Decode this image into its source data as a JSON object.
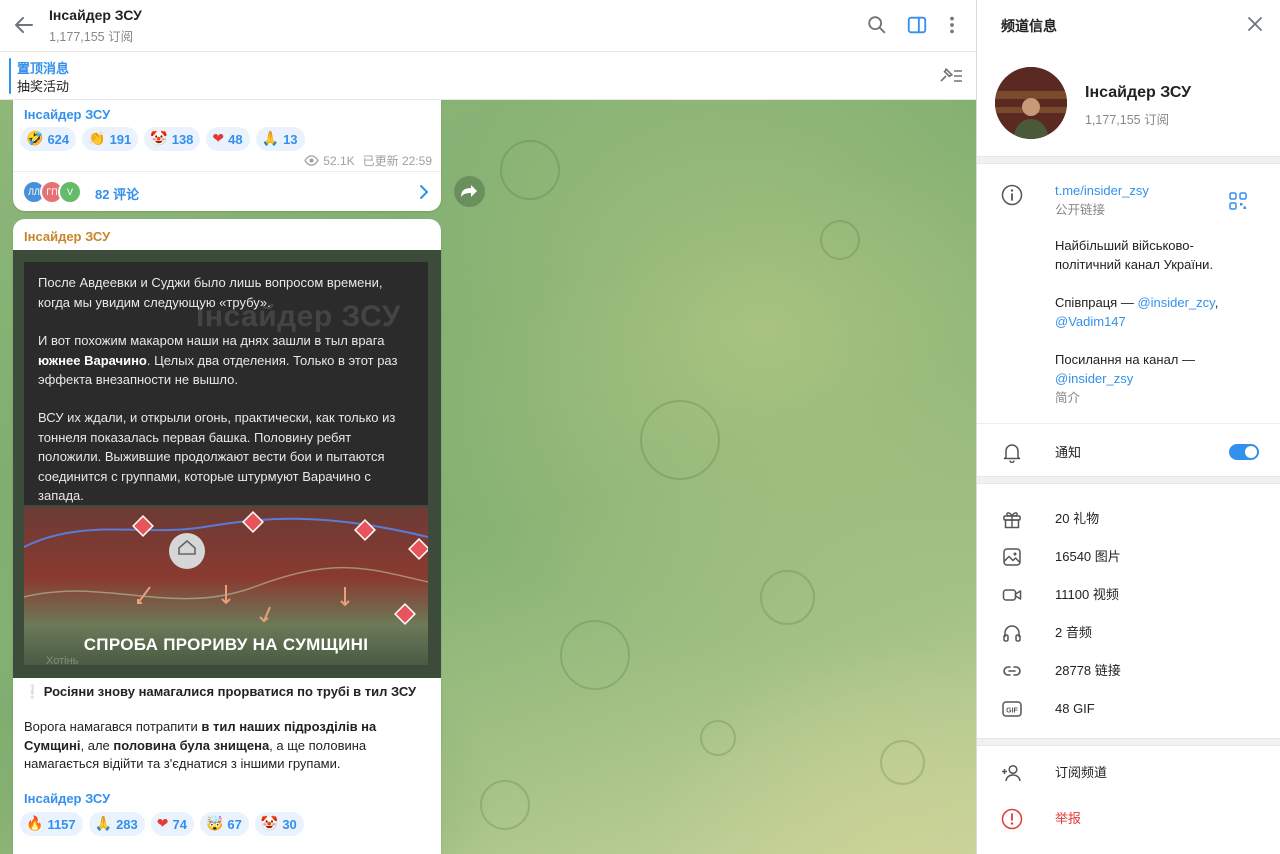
{
  "header": {
    "channel_name": "Інсайдер ЗСУ",
    "subscribers": "1,177,155 订阅"
  },
  "pinned": {
    "title": "置顶消息",
    "text": "抽奖活动"
  },
  "message1": {
    "author": "Інсайдер ЗСУ",
    "reactions": [
      {
        "emoji": "🤣",
        "count": "624"
      },
      {
        "emoji": "👏",
        "count": "191"
      },
      {
        "emoji": "🤡",
        "count": "138"
      },
      {
        "emoji": "❤",
        "count": "48"
      },
      {
        "emoji": "🙏",
        "count": "13"
      }
    ],
    "views": "52.1K",
    "time": "已更新 22:59",
    "commenter_initials": [
      "ЛЛ",
      "ГП",
      "V"
    ],
    "comments": "82 评论"
  },
  "message2": {
    "author": "Інсайдер ЗСУ",
    "image": {
      "paragraphs": [
        "После Авдеевки и Суджи было лишь вопросом времени, когда мы увидим следующую «трубу».",
        "И вот похожим макаром наши на днях зашли в тыл врага",
        "южнее Варачино",
        ". Целых два отделения. Только в этот раз эффекта внезапности не вышло.",
        "ВСУ их ждали, и открыли огонь, практически, как только из тоннеля показалась первая башка. Половину ребят положили. Выжившие продолжают вести бои и пытаются соединится с группами, которые штурмуют Варачино с запада."
      ],
      "watermark": "Інсайдер ЗСУ",
      "map_caption": "СПРОБА ПРОРИВУ НА СУМЩИНІ",
      "map_label": "Хотінь"
    },
    "headline": "❕ Росіяни знову намагалися прорватися по трубі в тил ЗСУ",
    "body": {
      "t1": "Ворога намагався потрапити ",
      "b1": "в тил наших підрозділів на Сумщині",
      "t2": ", але ",
      "b2": "половина була знищена",
      "t3": ", а ще половина намагається відійти та з'єднатися з іншими групами."
    },
    "signature": "Інсайдер ЗСУ",
    "reactions": [
      {
        "emoji": "🔥",
        "count": "1157"
      },
      {
        "emoji": "🙏",
        "count": "283"
      },
      {
        "emoji": "❤",
        "count": "74"
      },
      {
        "emoji": "🤯",
        "count": "67"
      },
      {
        "emoji": "🤡",
        "count": "30"
      }
    ]
  },
  "info_panel": {
    "title": "频道信息",
    "name": "Інсайдер ЗСУ",
    "subscribers": "1,177,155 订阅",
    "link": "t.me/insider_zsy",
    "link_label": "公开链接",
    "desc1": "Найбільший військово-політичний канал України.",
    "desc2_prefix": "Співпраця — ",
    "desc2_link1": "@insider_zcy",
    "desc2_sep": ",",
    "desc2_link2": "@Vadim147",
    "desc3_prefix": "Посилання на канал —",
    "desc3_link": "@insider_zsy",
    "desc_label": "简介",
    "notifications": "通知",
    "notifications_on": true,
    "stats": [
      {
        "icon": "gift-icon",
        "label": "20 礼物"
      },
      {
        "icon": "photo-icon",
        "label": "16540 图片"
      },
      {
        "icon": "video-icon",
        "label": "11100 视频"
      },
      {
        "icon": "headphones-icon",
        "label": "2 音频"
      },
      {
        "icon": "link-icon",
        "label": "28778 链接"
      },
      {
        "icon": "gif-icon",
        "label": "48 GIF"
      }
    ],
    "subscribe": "订阅频道",
    "report": "举报"
  },
  "colors": {
    "accent": "#3390ec",
    "author_gold": "#c8842a",
    "danger": "#e53935",
    "chat_green": "#86b274"
  }
}
